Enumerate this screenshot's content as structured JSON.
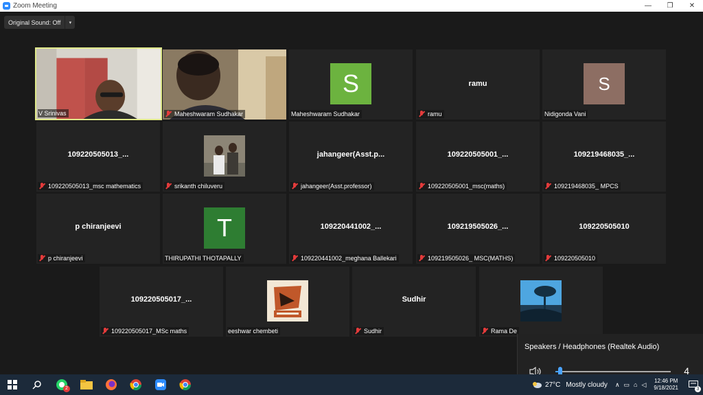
{
  "window": {
    "title": "Zoom Meeting",
    "minimize": "—",
    "restore": "❐",
    "close": "✕"
  },
  "toolbar": {
    "sound_label": "Original Sound: Off",
    "caret": "▾"
  },
  "tiles": [
    {
      "name": "V Srinivas",
      "kind": "video",
      "muted": false,
      "active": true
    },
    {
      "name": "Maheshwaram Sudhakar",
      "kind": "video",
      "muted": true
    },
    {
      "name": "Maheshwaram Sudhakar",
      "kind": "avatar",
      "letter": "S",
      "color": "#6cb33f",
      "muted": false
    },
    {
      "name": "ramu",
      "kind": "text",
      "big": "ramu",
      "muted": true
    },
    {
      "name": "Nidigonda Vani",
      "kind": "avatar",
      "letter": "S",
      "color": "#8d6e63",
      "muted": false
    },
    {
      "name": "109220505013_msc mathematics",
      "kind": "text",
      "big": "109220505013_...",
      "muted": true
    },
    {
      "name": "srikanth chiluveru",
      "kind": "photo",
      "muted": true
    },
    {
      "name": "jahangeer(Asst.professor)",
      "kind": "text",
      "big": "jahangeer(Asst.p...",
      "muted": true
    },
    {
      "name": "109220505001_msc(maths)",
      "kind": "text",
      "big": "109220505001_...",
      "muted": true
    },
    {
      "name": "109219468035_ MPCS",
      "kind": "text",
      "big": "109219468035_...",
      "muted": true
    },
    {
      "name": "p chiranjeevi",
      "kind": "text",
      "big": "p chiranjeevi",
      "muted": true
    },
    {
      "name": "THIRUPATHI THOTAPALLY",
      "kind": "avatar",
      "letter": "T",
      "color": "#2e7d32",
      "muted": false
    },
    {
      "name": "109220441002_meghana Ballekari",
      "kind": "text",
      "big": "109220441002_...",
      "muted": true
    },
    {
      "name": "109219505026_ MSC(MATHS)",
      "kind": "text",
      "big": "109219505026_...",
      "muted": true
    },
    {
      "name": "109220505010",
      "kind": "text",
      "big": "109220505010",
      "muted": true
    },
    {
      "name": "109220505017_MSc maths",
      "kind": "text",
      "big": "109220505017_...",
      "muted": true
    },
    {
      "name": "eeshwar chembeti",
      "kind": "logo",
      "muted": false
    },
    {
      "name": "Sudhir",
      "kind": "text",
      "big": "Sudhir",
      "muted": true
    },
    {
      "name": "Rama De",
      "kind": "tree",
      "muted": true
    }
  ],
  "audio_popup": {
    "title": "Speakers / Headphones (Realtek Audio)",
    "volume": "4",
    "volume_fraction": 0.04
  },
  "taskbar": {
    "weather_temp": "27°C",
    "weather_cond": "Mostly cloudy",
    "time": "12:46 PM",
    "date": "9/18/2021",
    "whatsapp_badge": "2",
    "notif_count": "3"
  }
}
